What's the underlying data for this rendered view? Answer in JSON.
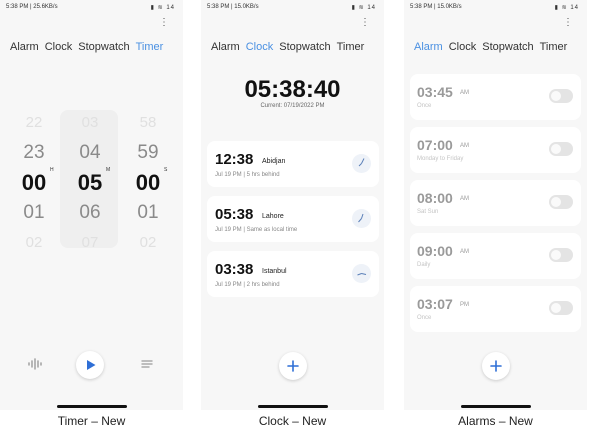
{
  "status_timer": {
    "time": "5:38 PM | 25.6KB/s",
    "icons": "▮ ≋ 14"
  },
  "status_clock": {
    "time": "5:38 PM | 15.0KB/s",
    "icons": "▮ ≋ 14"
  },
  "status_alarms": {
    "time": "5:38 PM | 15.0KB/s",
    "icons": "▮ ≋ 14"
  },
  "tabs": [
    "Alarm",
    "Clock",
    "Stopwatch",
    "Timer"
  ],
  "active_tabs": {
    "timer_screen": "Timer",
    "clock_screen": "Clock",
    "alarms_screen": "Alarm"
  },
  "timer": {
    "hours": [
      "22",
      "23",
      "00",
      "01",
      "02"
    ],
    "minutes": [
      "03",
      "04",
      "05",
      "06",
      "07"
    ],
    "seconds": [
      "58",
      "59",
      "00",
      "01",
      "02"
    ],
    "units": {
      "h": "H",
      "m": "M",
      "s": "S"
    },
    "controls": {
      "left_icon": "waveform-icon",
      "play_icon": "play-icon",
      "right_icon": "list-icon"
    }
  },
  "clock": {
    "big_time": "05:38:40",
    "current": "Current: 07/19/2022 PM",
    "cities": [
      {
        "time": "12:38",
        "name": "Abidjan",
        "info": "Jul 19 PM  |  5 hrs behind"
      },
      {
        "time": "05:38",
        "name": "Lahore",
        "info": "Jul 19 PM  |  Same as local time"
      },
      {
        "time": "03:38",
        "name": "Istanbul",
        "info": "Jul 19 PM  |  2 hrs behind"
      }
    ],
    "add_icon": "plus-icon"
  },
  "alarms": [
    {
      "time": "03:45",
      "ampm": "AM",
      "repeat": "Once"
    },
    {
      "time": "07:00",
      "ampm": "AM",
      "repeat": "Monday to Friday"
    },
    {
      "time": "08:00",
      "ampm": "AM",
      "repeat": "Sat Sun"
    },
    {
      "time": "09:00",
      "ampm": "AM",
      "repeat": "Daily"
    },
    {
      "time": "03:07",
      "ampm": "PM",
      "repeat": "Once"
    }
  ],
  "captions": {
    "timer": "Timer – New",
    "clock": "Clock – New",
    "alarms": "Alarms – New"
  },
  "colors": {
    "accent": "#4a90e2",
    "background": "#f7f7f7",
    "card": "#ffffff"
  }
}
